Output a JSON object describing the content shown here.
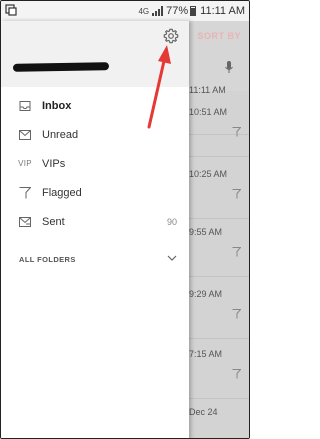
{
  "status_bar": {
    "signal_label": "4G",
    "battery_percent": "77%",
    "time": "11:11 AM"
  },
  "background": {
    "sort_label": "SORT BY",
    "times": [
      "11:11 AM",
      "10:51 AM",
      "10:25 AM",
      "9:55 AM",
      "9:29 AM",
      "7:15 AM",
      "Dec 24"
    ]
  },
  "drawer": {
    "nav_items": [
      {
        "label": "Inbox",
        "icon": "inbox-icon",
        "count": ""
      },
      {
        "label": "Unread",
        "icon": "envelope-icon",
        "count": ""
      },
      {
        "label": "VIPs",
        "icon": "vip-icon",
        "icon_text": "VIP",
        "count": ""
      },
      {
        "label": "Flagged",
        "icon": "flag-icon",
        "count": ""
      },
      {
        "label": "Sent",
        "icon": "sent-icon",
        "count": "90"
      }
    ],
    "folders_label": "ALL FOLDERS"
  },
  "colors": {
    "annotation_arrow": "#e53935",
    "drawer_header": "#f1f1f1",
    "background_list": "#d3d3d3"
  }
}
